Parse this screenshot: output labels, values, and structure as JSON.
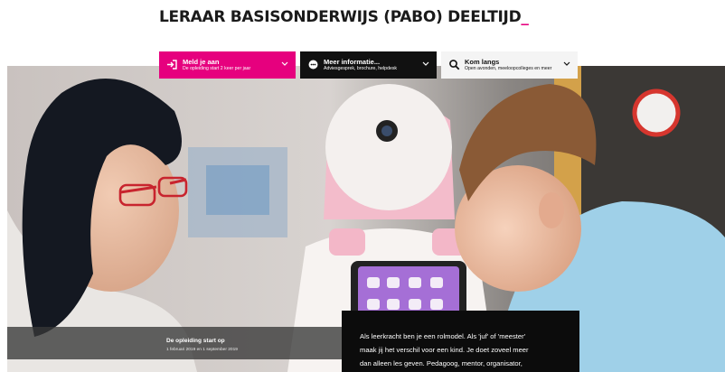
{
  "page": {
    "title": "LERAAR BASISONDERWIJS (PABO) DEELTIJD",
    "cursor": "_"
  },
  "actions": [
    {
      "label": "Meld je aan",
      "sub": "De opleiding start 2 keer per jaar",
      "icon": "sign-in-icon"
    },
    {
      "label": "Meer informatie...",
      "sub": "Adviesgesprek, brochure, helpdesk",
      "icon": "info-chat-icon"
    },
    {
      "label": "Kom langs",
      "sub": "Open avonden, meeloopcolleges en meer",
      "icon": "search-icon"
    }
  ],
  "hero": {
    "image": "teacher, robot and child photo"
  },
  "start": {
    "title": "De opleiding start op",
    "dates": "1 februari 2019 en 1 september 2019"
  },
  "quote": {
    "lines": [
      "Als leerkracht ben je een rolmodel. Als 'juf' of 'meester'",
      "maak jij het verschil voor een kind. Je doet zoveel meer",
      "dan alleen les geven. Pedagoog, mentor, organisator,"
    ]
  },
  "colors": {
    "accent": "#e6007e",
    "dark": "#111111",
    "light": "#f4f4f4"
  }
}
